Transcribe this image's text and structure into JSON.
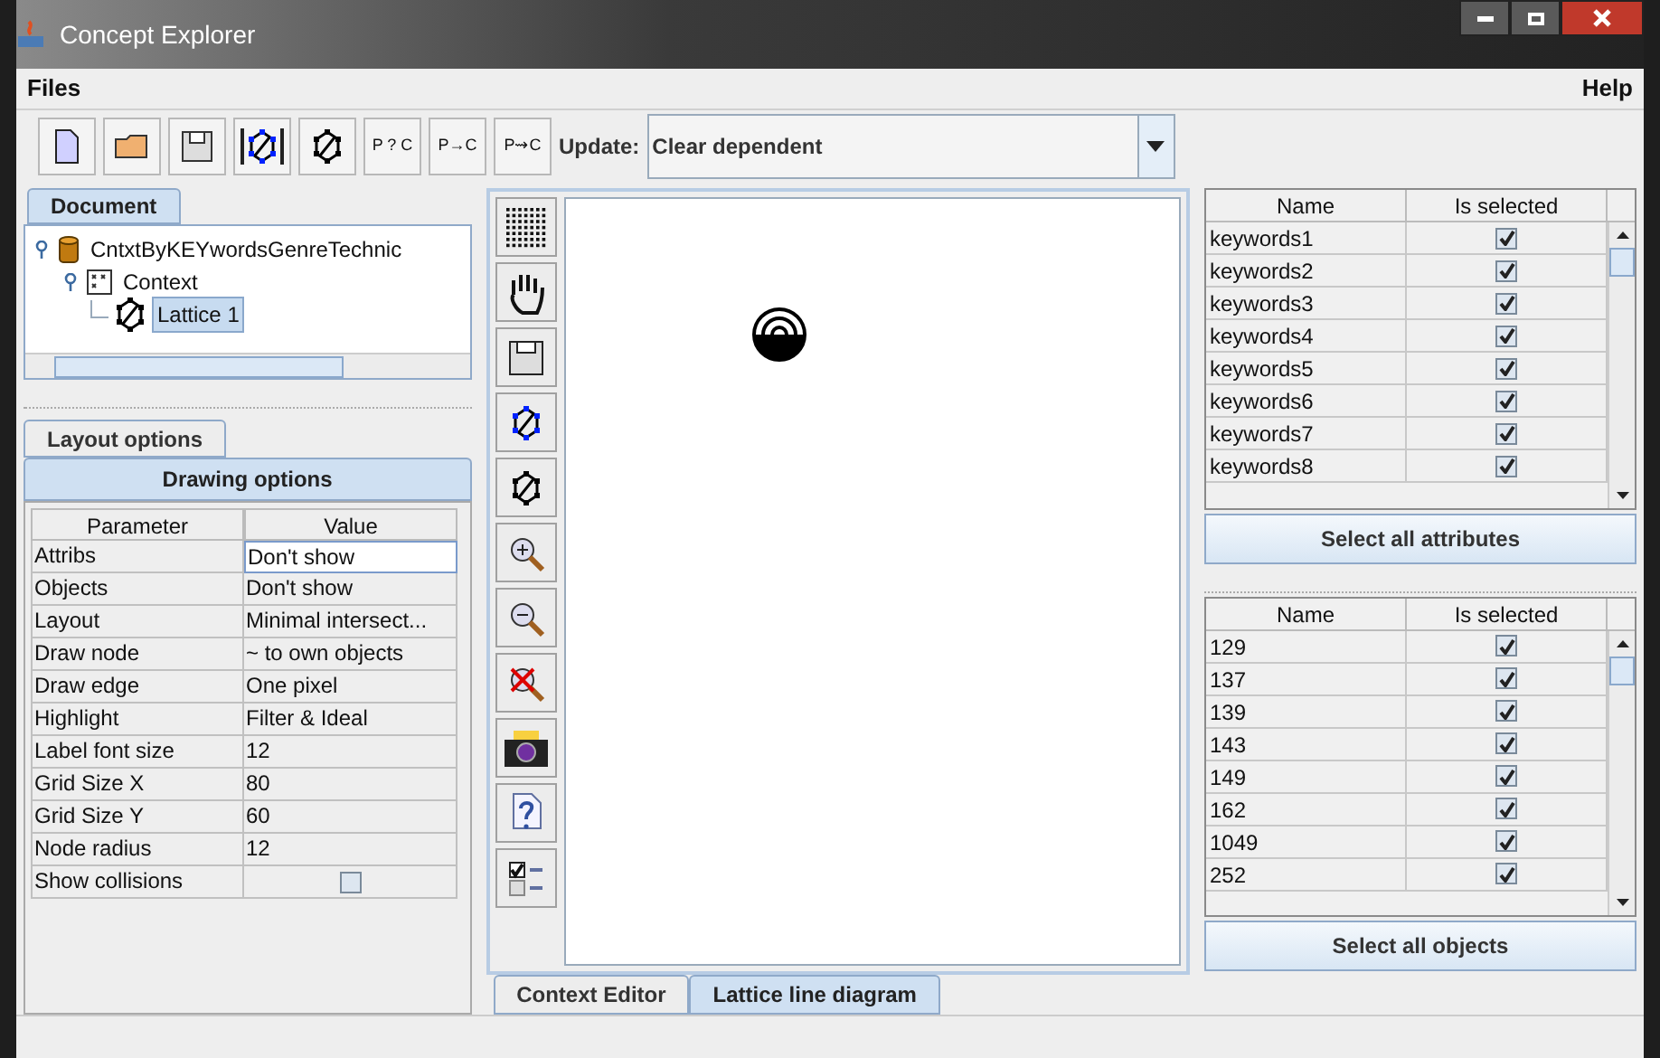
{
  "window": {
    "title": "Concept Explorer"
  },
  "menu": [
    "Files",
    "Help"
  ],
  "toolbar": {
    "text_buttons": [
      "P ? C",
      "P→C",
      "P⇝C"
    ],
    "update_label": "Update:",
    "update_value": "Clear dependent"
  },
  "document_tabs": [
    {
      "label": "Document",
      "selected": true
    }
  ],
  "tree": [
    {
      "label": "CntxtByKEYwordsGenreTechnic",
      "kind": "database",
      "selected": false,
      "children": [
        {
          "label": "Context",
          "kind": "context",
          "selected": false,
          "children": [
            {
              "label": "Lattice 1",
              "kind": "lattice",
              "selected": true
            }
          ]
        }
      ]
    }
  ],
  "option_tabs": [
    {
      "label": "Layout options",
      "selected": false
    },
    {
      "label": "Drawing options",
      "selected": true
    }
  ],
  "parameters": {
    "columns": [
      "Parameter",
      "Value"
    ],
    "rows": [
      {
        "name": "Attribs",
        "kind": "text",
        "value": "Don't show",
        "editing": true
      },
      {
        "name": "Objects",
        "kind": "text",
        "value": "Don't show",
        "editing": false
      },
      {
        "name": "Layout",
        "kind": "text",
        "value": "Minimal intersect...",
        "editing": false
      },
      {
        "name": "Draw node",
        "kind": "text",
        "value": "~ to own objects",
        "editing": false
      },
      {
        "name": "Draw edge",
        "kind": "text",
        "value": "One pixel",
        "editing": false
      },
      {
        "name": "Highlight",
        "kind": "text",
        "value": "Filter & Ideal",
        "editing": false
      },
      {
        "name": "Label font size",
        "kind": "text",
        "value": "12",
        "editing": false
      },
      {
        "name": "Grid Size X",
        "kind": "text",
        "value": "80",
        "editing": false
      },
      {
        "name": "Grid Size Y",
        "kind": "text",
        "value": "60",
        "editing": false
      },
      {
        "name": "Node radius",
        "kind": "text",
        "value": "12",
        "editing": false
      },
      {
        "name": "Show collisions",
        "kind": "checkbox",
        "checked": false
      }
    ]
  },
  "diagram_tabs": [
    {
      "label": "Context Editor",
      "selected": false
    },
    {
      "label": "Lattice line diagram",
      "selected": true
    }
  ],
  "attributes": {
    "columns": [
      "Name",
      "Is selected"
    ],
    "rows": [
      {
        "name": "keywords1",
        "checked": true
      },
      {
        "name": "keywords2",
        "checked": true
      },
      {
        "name": "keywords3",
        "checked": true
      },
      {
        "name": "keywords4",
        "checked": true
      },
      {
        "name": "keywords5",
        "checked": true
      },
      {
        "name": "keywords6",
        "checked": true
      },
      {
        "name": "keywords7",
        "checked": true
      },
      {
        "name": "keywords8",
        "checked": true
      }
    ],
    "button": "Select all attributes"
  },
  "objects": {
    "columns": [
      "Name",
      "Is selected"
    ],
    "rows": [
      {
        "name": "129",
        "checked": true
      },
      {
        "name": "137",
        "checked": true
      },
      {
        "name": "139",
        "checked": true
      },
      {
        "name": "143",
        "checked": true
      },
      {
        "name": "149",
        "checked": true
      },
      {
        "name": "162",
        "checked": true
      },
      {
        "name": "1049",
        "checked": true
      },
      {
        "name": "252",
        "checked": true
      }
    ],
    "button": "Select all objects"
  }
}
